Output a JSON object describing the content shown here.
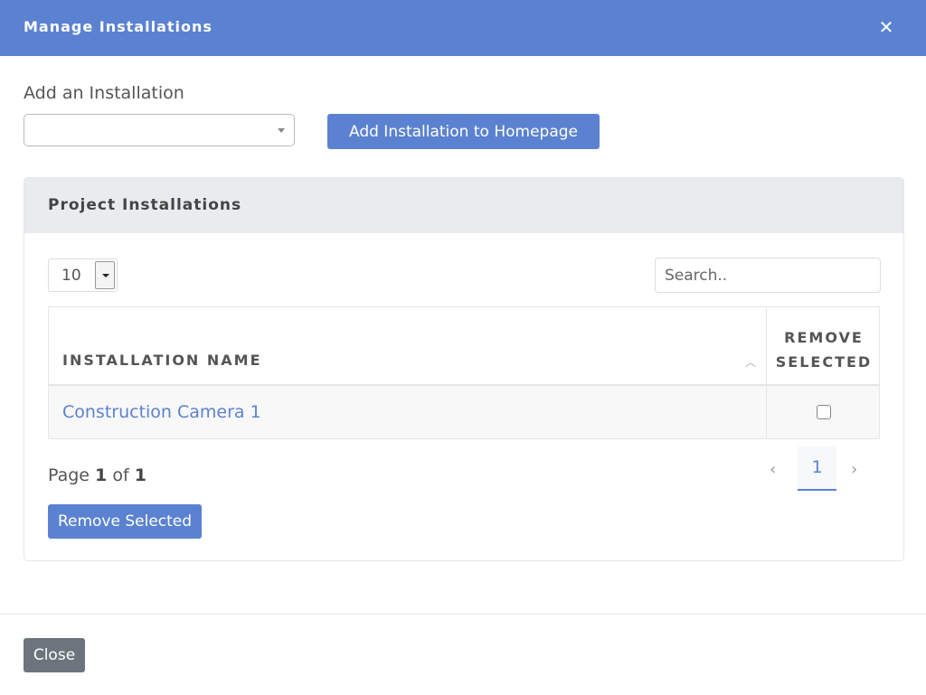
{
  "modal": {
    "title": "Manage Installations",
    "close_icon": "close-icon"
  },
  "add_section": {
    "label": "Add an Installation",
    "select_value": "",
    "button_label": "Add Installation to Homepage"
  },
  "panel": {
    "title": "Project Installations",
    "page_size": "10",
    "search_placeholder": "Search..",
    "columns": [
      "INSTALLATION NAME",
      "REMOVE SELECTED"
    ],
    "remove_col_line1": "REMOVE",
    "remove_col_line2": "SELECTED",
    "rows": [
      {
        "name": "Construction Camera 1",
        "selected": false
      }
    ],
    "pagination": {
      "page_word": "Page",
      "current": "1",
      "of_word": "of",
      "total": "1",
      "page_button": "1"
    },
    "remove_button_label": "Remove Selected"
  },
  "footer": {
    "close_label": "Close"
  },
  "colors": {
    "primary": "#5b82d1",
    "secondary": "#6c757d",
    "panel_heading": "#e9ecef"
  }
}
